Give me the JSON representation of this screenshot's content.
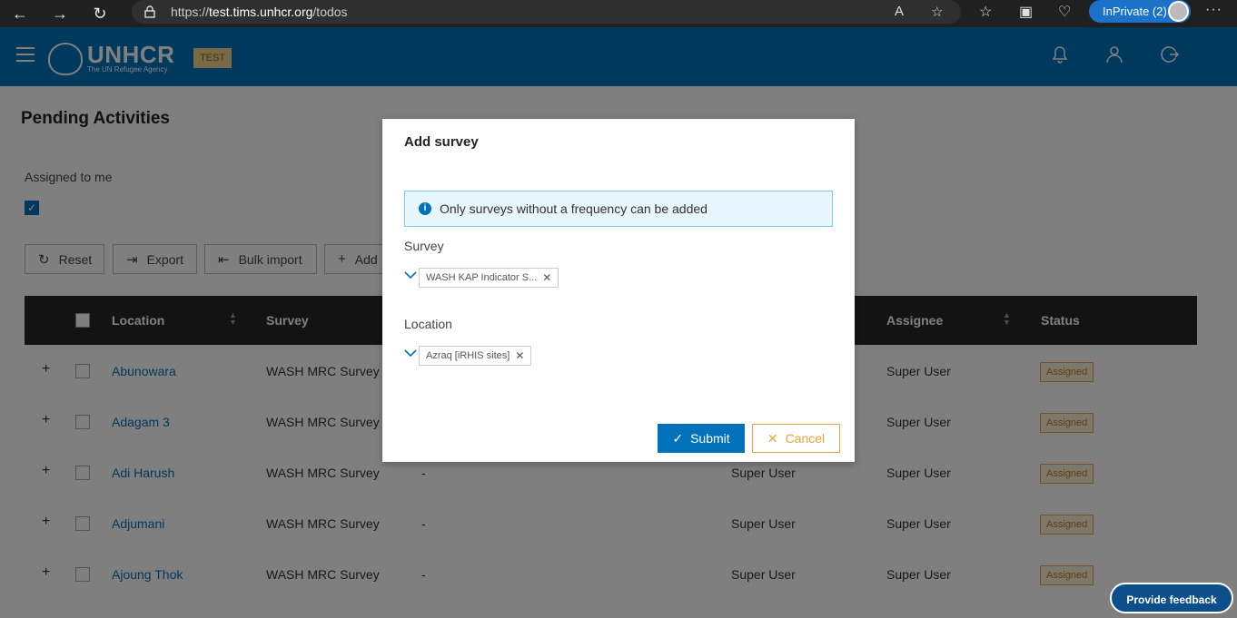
{
  "browser": {
    "url_prefix": "https://",
    "url_host": "test.tims.unhcr.org",
    "url_path": "/todos",
    "inprivate_label": "InPrivate (2)"
  },
  "header": {
    "logo_big": "UNHCR",
    "logo_small": "The UN Refugee Agency",
    "env_badge": "TEST"
  },
  "page": {
    "title": "Pending Activities",
    "assigned_label": "Assigned to me"
  },
  "toolbar": {
    "reset": "Reset",
    "export": "Export",
    "bulk_import": "Bulk import",
    "add": "Add"
  },
  "table": {
    "columns": [
      "Location",
      "Survey",
      "Assignee",
      "Status"
    ],
    "rows": [
      {
        "location": "Abunowara",
        "survey": "WASH MRC Survey",
        "dash": "",
        "assignee2": "",
        "assignee": "Super User",
        "status": "Assigned"
      },
      {
        "location": "Adagam 3",
        "survey": "WASH MRC Survey",
        "dash": "",
        "assignee2": "",
        "assignee": "Super User",
        "status": "Assigned"
      },
      {
        "location": "Adi Harush",
        "survey": "WASH MRC Survey",
        "dash": "-",
        "assignee2": "Super User",
        "assignee": "Super User",
        "status": "Assigned"
      },
      {
        "location": "Adjumani",
        "survey": "WASH MRC Survey",
        "dash": "-",
        "assignee2": "Super User",
        "assignee": "Super User",
        "status": "Assigned"
      },
      {
        "location": "Ajoung Thok",
        "survey": "WASH MRC Survey",
        "dash": "-",
        "assignee2": "Super User",
        "assignee": "Super User",
        "status": "Assigned"
      }
    ]
  },
  "modal": {
    "title": "Add survey",
    "info": "Only surveys without a frequency can be added",
    "survey_label": "Survey",
    "survey_chip": "WASH KAP Indicator S...",
    "location_label": "Location",
    "location_chip": "Azraq [iRHIS sites]",
    "submit": "Submit",
    "cancel": "Cancel"
  },
  "feedback": "Provide feedback",
  "colors": {
    "brand": "#0072bc",
    "warning": "#e6a33a"
  }
}
